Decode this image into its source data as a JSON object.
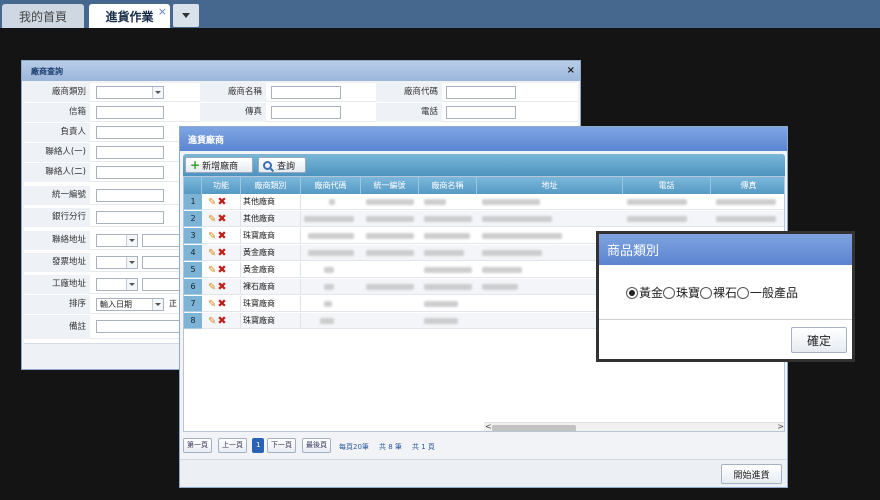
{
  "tabs": {
    "home_label": "我的首頁",
    "active_label": "進貨作業",
    "close_glyph": "×"
  },
  "query_window": {
    "title": "廠商查詢",
    "close_glyph": "×",
    "fields": {
      "vendor_category": "廠商類別",
      "vendor_name": "廠商名稱",
      "vendor_code": "廠商代碼",
      "email": "信箱",
      "fax": "傳真",
      "phone": "電話",
      "person_in_charge": "負責人",
      "contact_1": "聯絡人(一)",
      "contact_2": "聯絡人(二)",
      "tax_id": "統一編號",
      "branch": "銀行分行",
      "contact_address": "聯絡地址",
      "invoice_address": "發票地址",
      "factory_address": "工廠地址",
      "sort": "排序",
      "sort_value": "輸入日期",
      "sort_extra": "正",
      "note": "備註"
    }
  },
  "vendor_window": {
    "title": "進貨廠商",
    "toolbar": {
      "add_label": "新增廠商",
      "search_label": "查詢"
    },
    "columns": [
      "功能",
      "廠商類別",
      "廠商代碼",
      "統一編號",
      "廠商名稱",
      "地址",
      "電話",
      "傳真"
    ],
    "rows": [
      {
        "num": "1",
        "category": "其他廠商"
      },
      {
        "num": "2",
        "category": "其他廠商"
      },
      {
        "num": "3",
        "category": "珠寶廠商"
      },
      {
        "num": "4",
        "category": "黃金廠商"
      },
      {
        "num": "5",
        "category": "黃金廠商"
      },
      {
        "num": "6",
        "category": "裸石廠商"
      },
      {
        "num": "7",
        "category": "珠寶廠商"
      },
      {
        "num": "8",
        "category": "珠寶廠商"
      }
    ],
    "pager": {
      "first": "第一頁",
      "prev": "上一頁",
      "current": "1",
      "next": "下一頁",
      "last": "最後頁",
      "per_page": "每頁20筆",
      "total": "共 8 筆",
      "pages": "共 1 頁"
    },
    "start_button": "開始進貨"
  },
  "category_dialog": {
    "title": "商品類別",
    "options": [
      "黃金",
      "珠寶",
      "裸石",
      "一般產品"
    ],
    "selected": "黃金",
    "ok_label": "確定"
  },
  "colors": {
    "tabbar": "#46688f",
    "title_blue": "#5a85d1",
    "grid_header": "#5599c4",
    "page_background": "#141414"
  }
}
